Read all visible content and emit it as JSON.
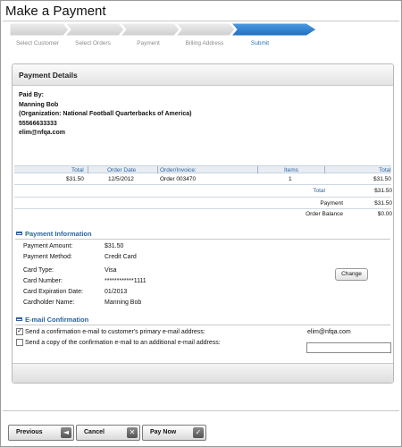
{
  "page": {
    "title": "Make a Payment"
  },
  "steps": [
    {
      "label": "Select Customer",
      "active": false
    },
    {
      "label": "Select Orders",
      "active": false
    },
    {
      "label": "Payment",
      "active": false
    },
    {
      "label": "Billing Address",
      "active": false
    },
    {
      "label": "Submit",
      "active": true
    }
  ],
  "payment_details": {
    "title": "Payment Details",
    "paid_by_label": "Paid By:",
    "name": "Manning Bob",
    "organization": "(Organization: National Football Quarterbacks of America)",
    "phone": "55566633333",
    "email": "elim@nfqa.com"
  },
  "orders_table": {
    "headers": [
      "Total",
      "Order Date",
      "Order/Invoice:",
      "Items",
      "Total"
    ],
    "rows": [
      {
        "total": "$31.50",
        "order_date": "12/5/2012",
        "order": "Order 003470",
        "items": "1",
        "line_total": "$31.50"
      }
    ],
    "total_label": "Total",
    "total_value": "$31.50",
    "payment_label": "Payment",
    "payment_value": "$31.50",
    "balance_label": "Order Balance",
    "balance_value": "$0.00"
  },
  "payment_info": {
    "title": "Payment Information",
    "amount_label": "Payment Amount:",
    "amount_value": "$31.50",
    "method_label": "Payment Method:",
    "method_value": "Credit Card",
    "card_type_label": "Card Type:",
    "card_type_value": "Visa",
    "card_number_label": "Card Number:",
    "card_number_value": "************1111",
    "expiration_label": "Card Expiration Date:",
    "expiration_value": "01/2013",
    "cardholder_label": "Cardholder Name:",
    "cardholder_value": "Manning Bob",
    "change_label": "Change"
  },
  "email_confirmation": {
    "title": "E-mail Confirmation",
    "primary_label": "Send a confirmation e-mail to customer's primary e-mail address:",
    "primary_checked": true,
    "primary_email": "elim@nfqa.com",
    "additional_label": "Send a copy of the confirmation e-mail to an additional e-mail address:",
    "additional_checked": false,
    "additional_value": ""
  },
  "footer_buttons": {
    "previous": "Previous",
    "cancel": "Cancel",
    "pay_now": "Pay Now"
  },
  "icons": {
    "previous": "arrow-left-icon",
    "cancel": "close-icon",
    "pay_now": "checkmark-icon",
    "section": "collapse-icon"
  },
  "colors": {
    "accent": "#2b64a0",
    "active_step": "#2b75b8"
  }
}
